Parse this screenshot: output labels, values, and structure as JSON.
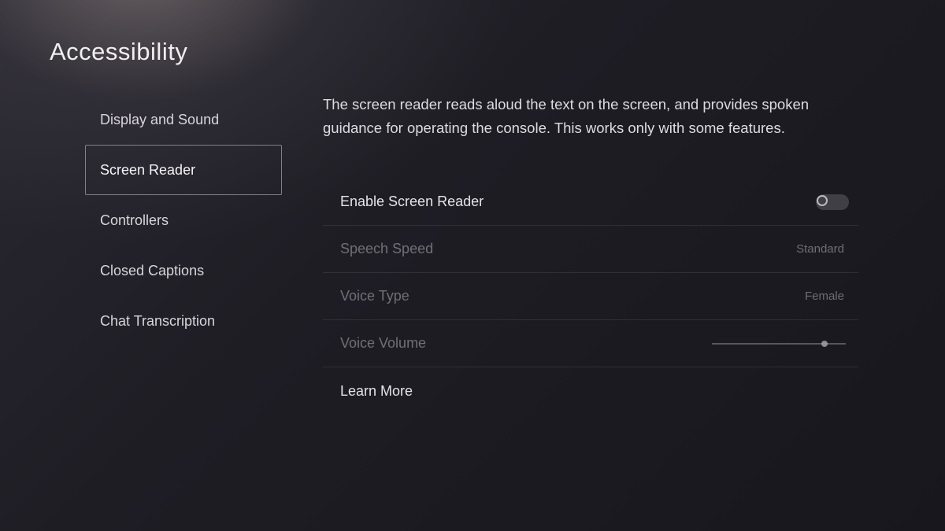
{
  "page": {
    "title": "Accessibility"
  },
  "sidebar": {
    "items": [
      {
        "label": "Display and Sound",
        "selected": false
      },
      {
        "label": "Screen Reader",
        "selected": true
      },
      {
        "label": "Controllers",
        "selected": false
      },
      {
        "label": "Closed Captions",
        "selected": false
      },
      {
        "label": "Chat Transcription",
        "selected": false
      }
    ]
  },
  "main": {
    "description": "The screen reader reads aloud the text on the screen, and provides spoken guidance for operating the console. This works only with some features.",
    "settings": {
      "enable": {
        "label": "Enable Screen Reader",
        "on": false
      },
      "speed": {
        "label": "Speech Speed",
        "value": "Standard"
      },
      "voice": {
        "label": "Voice Type",
        "value": "Female"
      },
      "volume": {
        "label": "Voice Volume",
        "percent": 82
      }
    },
    "learn_more": "Learn More"
  }
}
